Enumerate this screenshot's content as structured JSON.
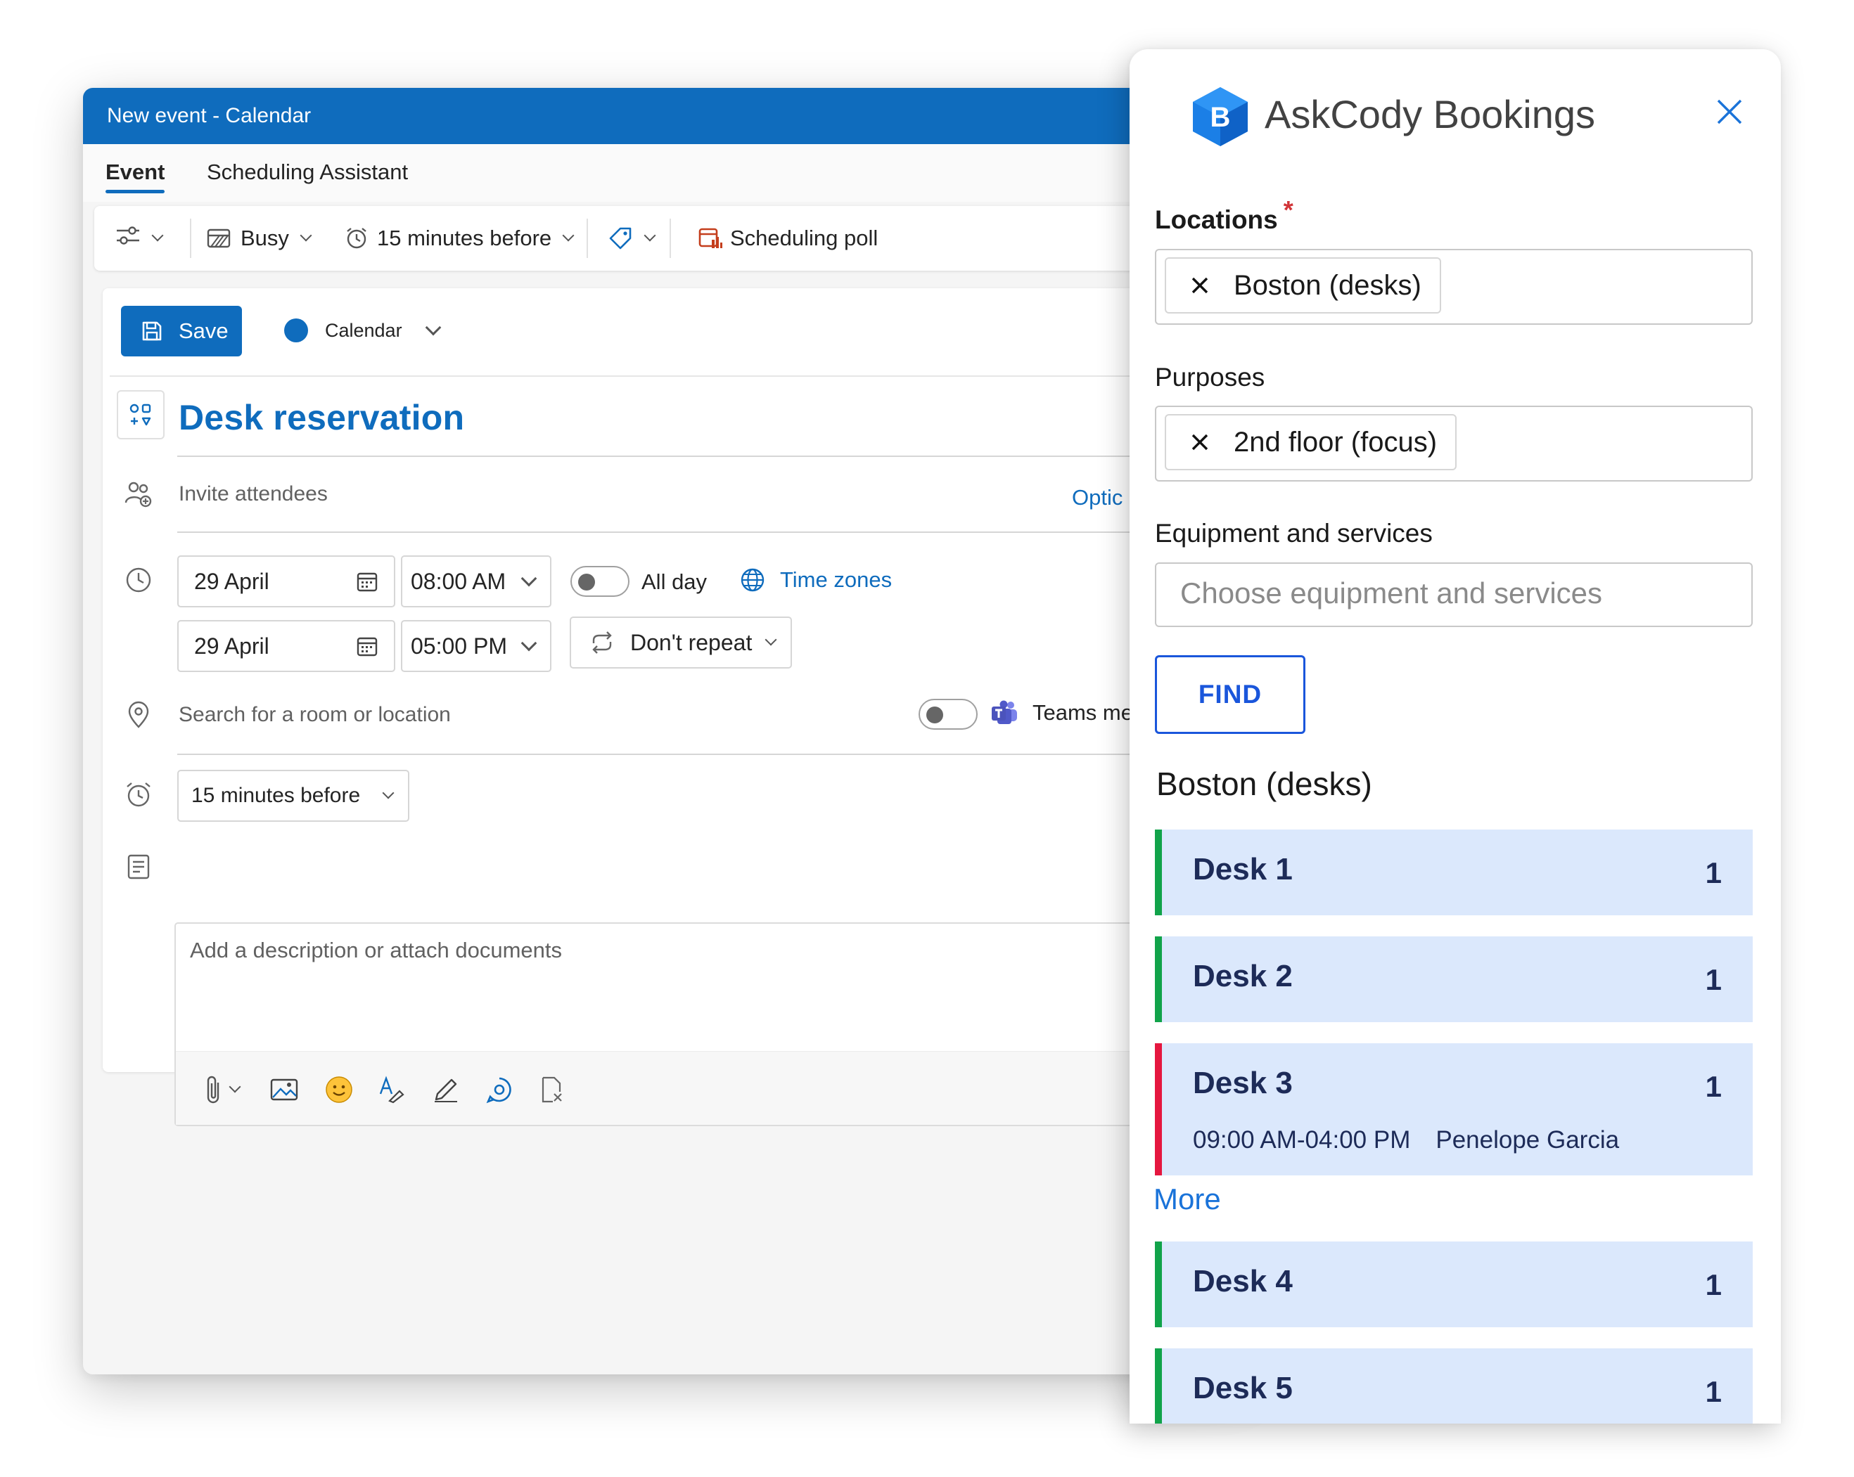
{
  "window": {
    "title": "New event - Calendar",
    "tabs": [
      {
        "label": "Event",
        "active": true
      },
      {
        "label": "Scheduling Assistant",
        "active": false
      }
    ]
  },
  "toolbar": {
    "show_as": "Busy",
    "reminder": "15 minutes before",
    "poll": "Scheduling poll"
  },
  "form": {
    "save_label": "Save",
    "calendar_label": "Calendar",
    "event_title": "Desk reservation",
    "attendees_placeholder": "Invite attendees",
    "optional_link": "Optic",
    "start_date": "29 April",
    "start_time": "08:00 AM",
    "end_date": "29 April",
    "end_time": "05:00 PM",
    "all_day_label": "All day",
    "all_day_on": false,
    "time_zones_label": "Time zones",
    "repeat_label": "Don't repeat",
    "location_placeholder": "Search for a room or location",
    "teams_label": "Teams meeti",
    "teams_on": false,
    "reminder": "15 minutes before",
    "description_placeholder": "Add a description or attach documents"
  },
  "panel": {
    "title": "AskCody Bookings",
    "logo_letter": "B",
    "locations_label": "Locations",
    "required_mark": "*",
    "locations": [
      "Boston (desks)"
    ],
    "purposes_label": "Purposes",
    "purposes": [
      "2nd floor (focus)"
    ],
    "equipment_label": "Equipment and services",
    "equipment_placeholder": "Choose equipment and services",
    "find_label": "FIND",
    "results_title": "Boston (desks)",
    "desks": [
      {
        "name": "Desk 1",
        "capacity": "1",
        "status": "available"
      },
      {
        "name": "Desk 2",
        "capacity": "1",
        "status": "available"
      },
      {
        "name": "Desk 3",
        "capacity": "1",
        "status": "booked",
        "booking_time": "09:00 AM-04:00 PM",
        "booking_person": "Penelope Garcia"
      },
      {
        "name": "Desk 4",
        "capacity": "1",
        "status": "available"
      },
      {
        "name": "Desk 5",
        "capacity": "1",
        "status": "available"
      }
    ],
    "more_label": "More"
  },
  "colors": {
    "outlook_blue": "#0f6cbd",
    "panel_find_blue": "#1a56db",
    "desk_available": "#11a34a",
    "desk_booked": "#e5173f",
    "desk_background": "#dbe8fc"
  },
  "icons": [
    "settings-sliders-icon",
    "busy-icon",
    "alarm-clock-icon",
    "tag-icon",
    "poll-icon",
    "save-icon",
    "reservation-icon",
    "people-add-icon",
    "clock-icon",
    "calendar-icon",
    "repeat-icon",
    "globe-icon",
    "location-pin-icon",
    "teams-icon",
    "notes-icon",
    "attach-icon",
    "image-icon",
    "emoji-icon",
    "editor-icon",
    "pen-icon",
    "loop-icon",
    "sign-icon",
    "close-icon",
    "remove-chip-icon"
  ]
}
